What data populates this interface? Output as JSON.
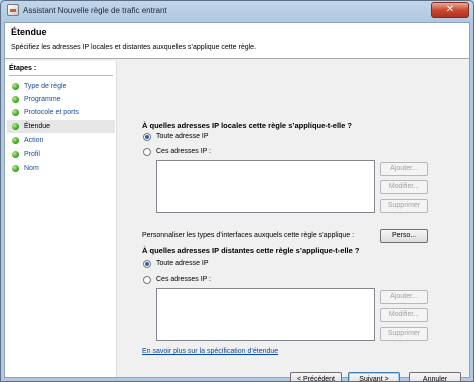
{
  "window": {
    "title": "Assistant Nouvelle règle de trafic entrant",
    "close_glyph": "✕"
  },
  "header": {
    "title": "Étendue",
    "subtitle": "Spécifiez les adresses IP locales et distantes auxquelles s’applique cette règle."
  },
  "steps": {
    "title": "Étapes :",
    "items": [
      {
        "label": "Type de règle",
        "active": false
      },
      {
        "label": "Programme",
        "active": false
      },
      {
        "label": "Protocole et ports",
        "active": false
      },
      {
        "label": "Étendue",
        "active": true
      },
      {
        "label": "Action",
        "active": false
      },
      {
        "label": "Profil",
        "active": false
      },
      {
        "label": "Nom",
        "active": false
      }
    ]
  },
  "local": {
    "question": "À quelles adresses IP locales cette règle s’applique-t-elle ?",
    "any_label": "Toute adresse IP",
    "these_label": "Ces adresses IP :",
    "selected": "any",
    "buttons": {
      "add": "Ajouter...",
      "modify": "Modifier...",
      "delete": "Supprimer"
    }
  },
  "interfaces": {
    "text": "Personnaliser les types d’interfaces auxquels cette règle s’applique :",
    "button": "Perso..."
  },
  "remote": {
    "question": "À quelles adresses IP distantes cette règle s’applique-t-elle ?",
    "any_label": "Toute adresse IP",
    "these_label": "Ces adresses IP :",
    "selected": "any",
    "buttons": {
      "add": "Ajouter...",
      "modify": "Modifier...",
      "delete": "Supprimer"
    }
  },
  "learn_more": "En savoir plus sur la spécification d’étendue",
  "footer": {
    "back": "< Précédent",
    "next": "Suivant >",
    "cancel": "Annuler"
  }
}
